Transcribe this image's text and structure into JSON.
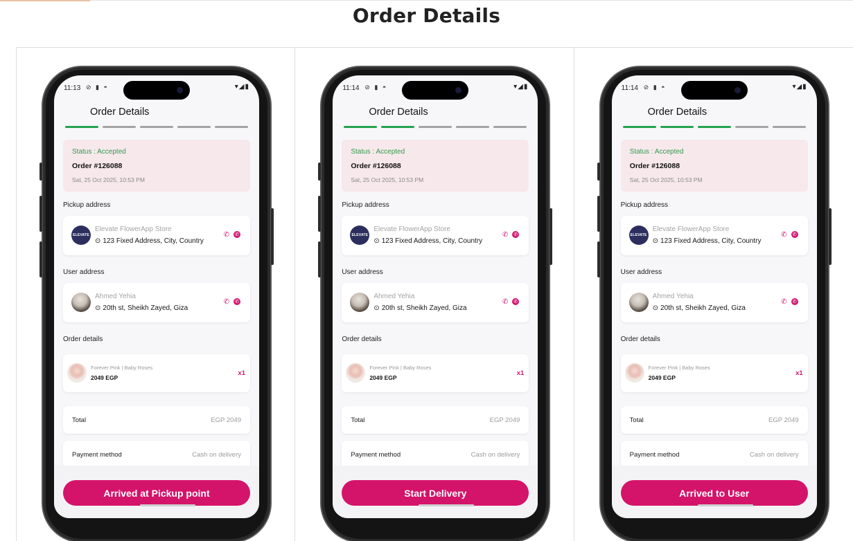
{
  "page": {
    "title": "Order Details"
  },
  "colors": {
    "accent": "#d4136a",
    "success": "#26a24e",
    "status_card_bg": "#f7e8ec"
  },
  "phones": [
    {
      "time": "11:13",
      "screen_title": "Order Details",
      "progress_done": 1,
      "progress_total": 5,
      "status": "Status : Accepted",
      "order_no": "Order #126088",
      "order_date": "Sat, 25 Oct 2025, 10:53 PM",
      "pickup_label": "Pickup address",
      "store_name": "Elevate FlowerApp Store",
      "store_logo_text": "ELEVATE",
      "store_address": "123 Fixed Address, City, Country",
      "user_label": "User address",
      "user_name": "Ahmed Yehia",
      "user_address": "20th st, Sheikh Zayed, Giza",
      "details_label": "Order details",
      "item_name": "Forever Pink | Baby Roses",
      "item_price": "2049 EGP",
      "item_qty": "x1",
      "total_label": "Total",
      "total_value": "EGP 2049",
      "payment_label": "Payment method",
      "payment_value": "Cash on delivery",
      "action_label": "Arrived at Pickup point"
    },
    {
      "time": "11:14",
      "screen_title": "Order Details",
      "progress_done": 2,
      "progress_total": 5,
      "status": "Status : Accepted",
      "order_no": "Order #126088",
      "order_date": "Sat, 25 Oct 2025, 10:53 PM",
      "pickup_label": "Pickup address",
      "store_name": "Elevate FlowerApp Store",
      "store_logo_text": "ELEVATE",
      "store_address": "123 Fixed Address, City, Country",
      "user_label": "User address",
      "user_name": "Ahmed Yehia",
      "user_address": "20th st, Sheikh Zayed, Giza",
      "details_label": "Order details",
      "item_name": "Forever Pink | Baby Roses",
      "item_price": "2049 EGP",
      "item_qty": "x1",
      "total_label": "Total",
      "total_value": "EGP 2049",
      "payment_label": "Payment method",
      "payment_value": "Cash on delivery",
      "action_label": "Start Delivery"
    },
    {
      "time": "11:14",
      "screen_title": "Order Details",
      "progress_done": 3,
      "progress_total": 5,
      "status": "Status : Accepted",
      "order_no": "Order #126088",
      "order_date": "Sat, 25 Oct 2025, 10:53 PM",
      "pickup_label": "Pickup address",
      "store_name": "Elevate FlowerApp Store",
      "store_logo_text": "ELEVATE",
      "store_address": "123 Fixed Address, City, Country",
      "user_label": "User address",
      "user_name": "Ahmed Yehia",
      "user_address": "20th st, Sheikh Zayed, Giza",
      "details_label": "Order details",
      "item_name": "Forever Pink | Baby Roses",
      "item_price": "2049 EGP",
      "item_qty": "x1",
      "total_label": "Total",
      "total_value": "EGP 2049",
      "payment_label": "Payment method",
      "payment_value": "Cash on delivery",
      "action_label": "Arrived to User"
    }
  ]
}
